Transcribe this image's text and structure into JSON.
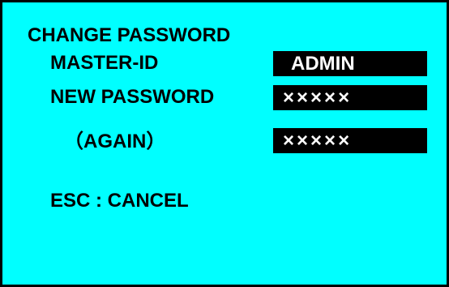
{
  "screen": {
    "title": "CHANGE PASSWORD",
    "master_id": {
      "label": "MASTER-ID",
      "value": "ADMIN"
    },
    "new_password": {
      "label": "NEW PASSWORD",
      "value": "×××××"
    },
    "again": {
      "label": "（AGAIN）",
      "value": "×××××"
    },
    "esc_hint": "ESC : CANCEL"
  },
  "colors": {
    "background": "#00ffff",
    "field_background": "#000000",
    "field_text": "#ffffff",
    "text": "#000000"
  }
}
